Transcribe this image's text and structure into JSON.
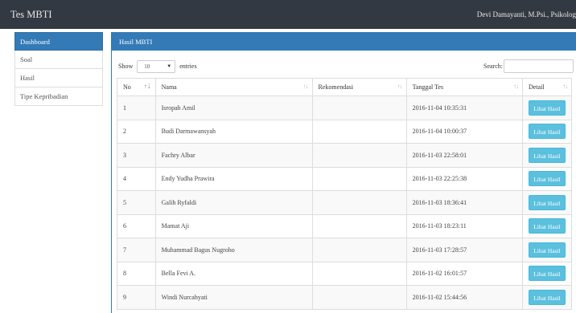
{
  "app": {
    "title": "Tes MBTI",
    "user": "Devi Damayanti, M.Psi., Psikolog"
  },
  "sidebar": {
    "items": [
      {
        "label": "Dashboard",
        "active": true
      },
      {
        "label": "Soal"
      },
      {
        "label": "Hasil"
      },
      {
        "label": "Tipe Kepribadian"
      }
    ]
  },
  "panel": {
    "title": "Hasil MBTI"
  },
  "controls": {
    "show_label": "Show",
    "length_value": "10",
    "entries_label": "entries",
    "search_label": "Search:"
  },
  "table": {
    "headers": [
      "No",
      "Nama",
      "Rekomendasi",
      "Tanggal Tes",
      "Detail"
    ],
    "button_label": "Lihat Hasil",
    "rows": [
      {
        "no": "1",
        "nama": "Isropah Amil",
        "rekomendasi": "",
        "tanggal": "2016-11-04 10:35:31"
      },
      {
        "no": "2",
        "nama": "Budi Darmawansyah",
        "rekomendasi": "",
        "tanggal": "2016-11-04 10:00:37"
      },
      {
        "no": "3",
        "nama": "Fachry Albar",
        "rekomendasi": "",
        "tanggal": "2016-11-03 22:58:01"
      },
      {
        "no": "4",
        "nama": "Endy Yudha Prawira",
        "rekomendasi": "",
        "tanggal": "2016-11-03 22:25:38"
      },
      {
        "no": "5",
        "nama": "Galih Ryfaldi",
        "rekomendasi": "",
        "tanggal": "2016-11-03 18:36:41"
      },
      {
        "no": "6",
        "nama": "Mamat Aji",
        "rekomendasi": "",
        "tanggal": "2016-11-03 18:23:11"
      },
      {
        "no": "7",
        "nama": "Muhammad Bagus Nugroho",
        "rekomendasi": "",
        "tanggal": "2016-11-03 17:28:57"
      },
      {
        "no": "8",
        "nama": "Bella Fevi A.",
        "rekomendasi": "",
        "tanggal": "2016-11-02 16:01:57"
      },
      {
        "no": "9",
        "nama": "Windi Nurcahyati",
        "rekomendasi": "",
        "tanggal": "2016-11-02 15:44:56"
      }
    ]
  },
  "colors": {
    "topbar": "#333942",
    "primary": "#337ab7",
    "info_button": "#5bc0de"
  }
}
